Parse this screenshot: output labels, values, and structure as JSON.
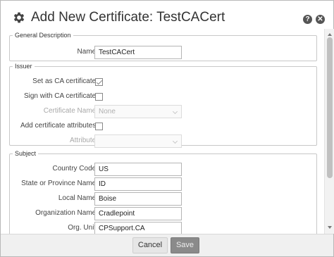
{
  "dialog": {
    "title": "Add New Certificate: TestCACert",
    "help_icon": "help-icon",
    "close_icon": "close-icon",
    "header_icon": "gear-icon"
  },
  "general": {
    "legend": "General Description",
    "name_label": "Name:",
    "name_value": "TestCACert"
  },
  "issuer": {
    "legend": "Issuer",
    "set_ca_label": "Set as CA certificate:",
    "set_ca_checked": true,
    "sign_ca_label": "Sign with CA certificate:",
    "sign_ca_checked": false,
    "cert_name_label": "Certificate Name:",
    "cert_name_value": "None",
    "add_attr_label": "Add certificate attributes:",
    "add_attr_checked": false,
    "attribute_label": "Attribute:",
    "attribute_value": ""
  },
  "subject": {
    "legend": "Subject",
    "country_label": "Country Code:",
    "country_value": "US",
    "state_label": "State or Province Name:",
    "state_value": "ID",
    "local_label": "Local Name:",
    "local_value": "Boise",
    "org_label": "Organization Name:",
    "org_value": "Cradlepoint",
    "unit_label": "Org. Unit:",
    "unit_value": "CPSupport.CA"
  },
  "footer": {
    "cancel_label": "Cancel",
    "save_label": "Save"
  }
}
